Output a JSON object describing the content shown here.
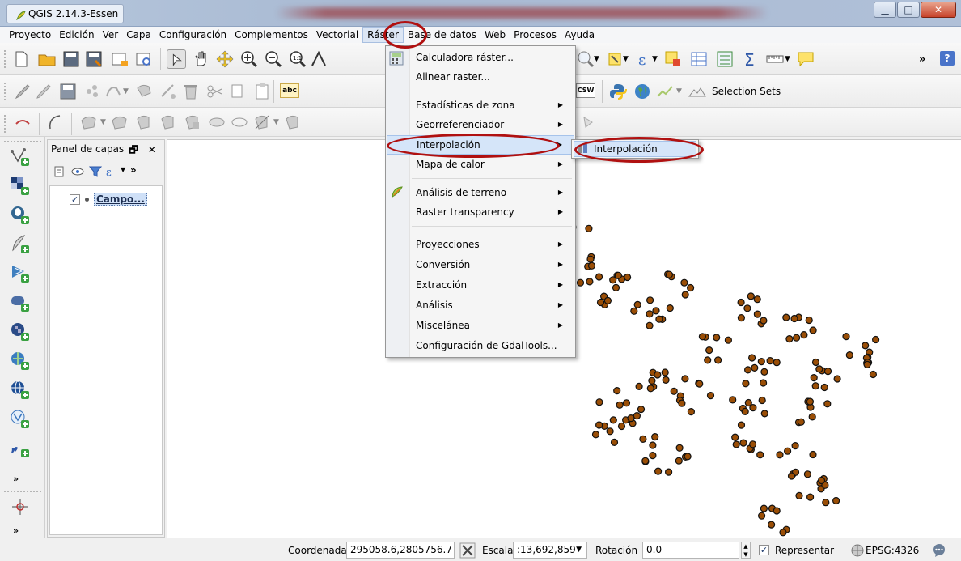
{
  "window": {
    "title": "QGIS 2.14.3-Essen"
  },
  "menubar": {
    "items": [
      "Proyecto",
      "Edición",
      "Ver",
      "Capa",
      "Configuración",
      "Complementos",
      "Vectorial",
      "Ráster",
      "Base de datos",
      "Web",
      "Procesos",
      "Ayuda"
    ],
    "active": "Ráster"
  },
  "toolbar2": {
    "selection_sets": "Selection Sets",
    "csw_label": "CSW",
    "abc_label": "abc"
  },
  "layers_panel": {
    "title": "Panel de capas",
    "controls": "🗗 ✕",
    "more": "»",
    "layer": {
      "name": "Campo...",
      "checked": "✓"
    }
  },
  "raster_menu": {
    "items": [
      {
        "label": "Calculadora ráster...",
        "submenu": false
      },
      {
        "label": "Alinear raster...",
        "submenu": false
      },
      {
        "label": "Estadísticas de zona",
        "submenu": true
      },
      {
        "label": "Georreferenciador",
        "submenu": true
      },
      {
        "label": "Interpolación",
        "submenu": true,
        "highlighted": true
      },
      {
        "label": "Mapa de calor",
        "submenu": true
      },
      {
        "label": "Análisis de terreno",
        "submenu": true
      },
      {
        "label": "Raster transparency",
        "submenu": true
      },
      {
        "label": "Proyecciones",
        "submenu": true
      },
      {
        "label": "Conversión",
        "submenu": true
      },
      {
        "label": "Extracción",
        "submenu": true
      },
      {
        "label": "Análisis",
        "submenu": true
      },
      {
        "label": "Miscelánea",
        "submenu": true
      },
      {
        "label": "Configuración de GdalTools...",
        "submenu": false
      }
    ],
    "arrow": "▶"
  },
  "interpolation_submenu": {
    "label": "Interpolación"
  },
  "statusbar": {
    "coord_label": "Coordenada",
    "coord_value": "295058.6,2805756.7",
    "scale_label": "Escala",
    "scale_value": ":13,692,859",
    "rotation_label": "Rotación",
    "rotation_value": "0.0",
    "render_label": "Representar",
    "render_checked": "✓",
    "crs": "EPSG:4326"
  },
  "colors": {
    "point_fill": "#9a4e06",
    "annotation": "#b01010",
    "highlight": "#d5e5f9"
  }
}
